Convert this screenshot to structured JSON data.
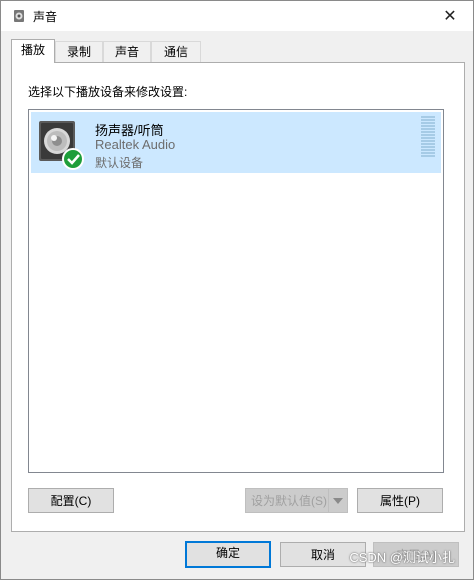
{
  "window": {
    "title": "声音",
    "close_glyph": "✕"
  },
  "tabs": [
    {
      "label": "播放",
      "active": true
    },
    {
      "label": "录制",
      "active": false
    },
    {
      "label": "声音",
      "active": false
    },
    {
      "label": "通信",
      "active": false
    }
  ],
  "panel": {
    "instruction": "选择以下播放设备来修改设置:"
  },
  "devices": [
    {
      "name": "扬声器/听筒",
      "driver": "Realtek Audio",
      "status": "默认设备",
      "icon": "speaker-icon",
      "badge": "check-icon",
      "selected": true
    }
  ],
  "buttons": {
    "configure": "配置(C)",
    "set_default": "设为默认值(S)",
    "properties": "属性(P)",
    "ok": "确定",
    "cancel": "取消",
    "apply": "应用(A)"
  },
  "watermark": "CSDN @测试小扎",
  "colors": {
    "selection": "#cce8ff",
    "accent": "#0078d7",
    "check_badge": "#1e9e3a"
  }
}
